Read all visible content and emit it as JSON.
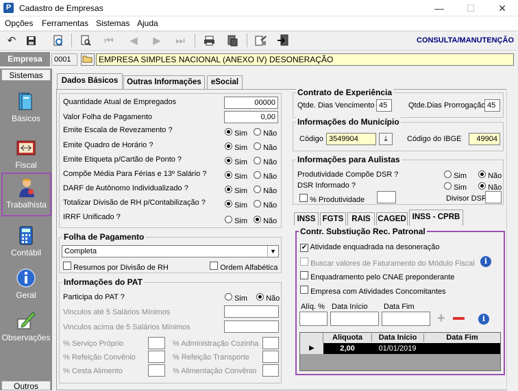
{
  "window": {
    "title": "Cadastro de Empresas",
    "min": "—",
    "max": "☐",
    "close": "✕",
    "app_icon": "P"
  },
  "menu": [
    "Opções",
    "Ferramentas",
    "Sistemas",
    "Ajuda"
  ],
  "toolbar": {
    "mode": "CONSULTA/MANUTENÇÃO"
  },
  "empresa": {
    "label": "Empresa",
    "code": "0001",
    "name": "EMPRESA SIMPLES NACIONAL (ANEXO IV) DESONERAÇÃO"
  },
  "sidebar": {
    "header": "Sistemas",
    "items": [
      "Básicos",
      "Fiscal",
      "Trabalhista",
      "Contábil",
      "Geral",
      "Observações"
    ],
    "footer": "Outros"
  },
  "tabs": [
    "Dados Básicos",
    "Outras Informações",
    "eSocial"
  ],
  "dados": {
    "qtd_label": "Quantidade Atual de Empregados",
    "qtd_value": "00000",
    "folha_label": "Valor Folha de Pagamento",
    "folha_value": "0,00",
    "questions": [
      {
        "label": "Emite Escala de Revezamento ?",
        "sim": "Sim",
        "nao": "Não"
      },
      {
        "label": "Emite Quadro de Horário ?",
        "sim": "Sim",
        "nao": "Não"
      },
      {
        "label": "Emite Etiqueta p/Cartão de Ponto ?",
        "sim": "Sim",
        "nao": "Não"
      },
      {
        "label": "Compõe Média Para Férias e 13º Salário ?",
        "sim": "Sim",
        "nao": "Não"
      },
      {
        "label": "DARF de Autônomo Individualizado ?",
        "sim": "Sim",
        "nao": "Não"
      },
      {
        "label": "Totalizar Divisão de RH p/Contabilização ?",
        "sim": "Sim",
        "nao": "Não"
      },
      {
        "label": "IRRF Unificado ?",
        "sim": "Sim",
        "nao": "Não"
      }
    ]
  },
  "folha": {
    "title": "Folha de Pagamento",
    "select": "Completa",
    "resumos": "Resumos por Divisão de RH",
    "ordem": "Ordem Alfabética"
  },
  "pat": {
    "title": "Informações do PAT",
    "participa": "Participa do PAT ?",
    "sim": "Sim",
    "nao": "Não",
    "ate5": "Vinculos até 5 Salários Mínimos",
    "acima5": "Vinculos acima de 5 Salários Mínimos",
    "servico": "% Serviço Próprio",
    "admcoz": "% Administração Cozinha",
    "refconv": "% Refeição Convênio",
    "reftrans": "% Refeição Transporte",
    "cesta": "% Cesta Alimento",
    "alimconv": "% Alimentação Convênio"
  },
  "contrato": {
    "title": "Contrato de Experiência",
    "venc_label": "Qtde. Dias Vencimento",
    "venc": "45",
    "prorr_label": "Qtde.Dias Prorrogação",
    "prorr": "45"
  },
  "municipio": {
    "title": "Informações do Município",
    "cod_label": "Código",
    "cod": "3549904",
    "ibge_label": "Código do IBGE",
    "ibge": "49904"
  },
  "aulistas": {
    "title": "Informações para Aulistas",
    "prod": "Produtividade Compõe DSR ?",
    "dsr": "DSR Informado ?",
    "sim": "Sim",
    "nao": "Não",
    "pct": "% Produtividade",
    "divisor": "Divisor DSR"
  },
  "subtabs": [
    "INSS",
    "FGTS",
    "RAIS",
    "CAGED",
    "INSS - CPRB"
  ],
  "cprb": {
    "title": "Contr. Substiução Rec. Patronal",
    "ativ": "Atividade enquadrada na desoneração",
    "buscar": "Buscar valores de Faturamento do Módulo Fiscal",
    "cnae": "Enquadramento pelo CNAE preponderante",
    "conc": "Empresa com Atividades Concomitantes",
    "aliq_label": "Alíq. %",
    "ini_label": "Data Início",
    "fim_label": "Data Fim",
    "cols": [
      "Aliquota",
      "Data Início",
      "Data Fim"
    ],
    "row": {
      "aliquota": "2,00",
      "inicio": "01/01/2019",
      "fim": ""
    }
  },
  "colors": {
    "accent": "#9c4fb4",
    "sidebar": "#8c8c8c",
    "navy": "#000080"
  }
}
